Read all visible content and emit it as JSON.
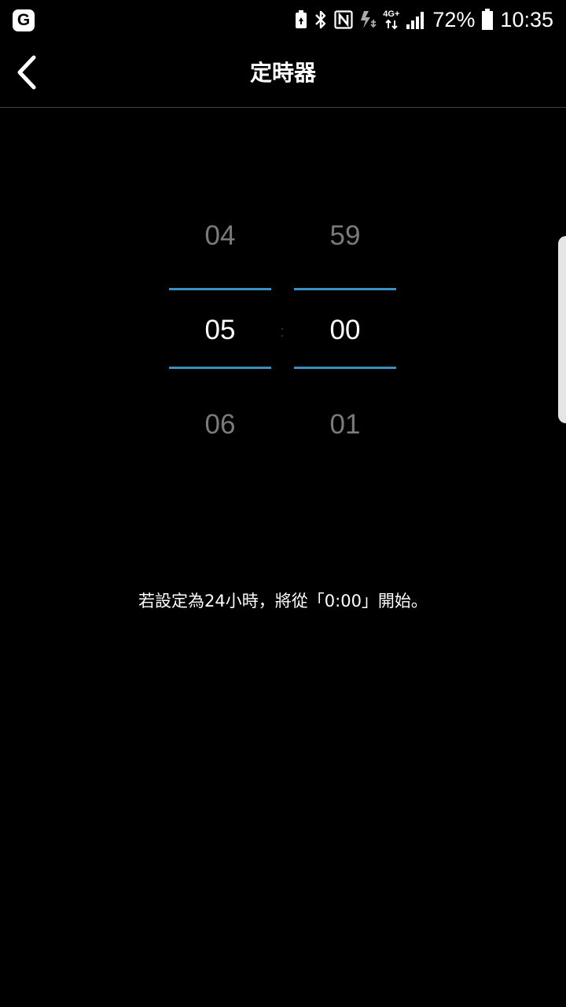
{
  "status_bar": {
    "app_icon_letter": "G",
    "network": "4G+",
    "battery_percent": "72%",
    "time": "10:35",
    "icons": [
      "app-g-icon",
      "battery-saver-icon",
      "bluetooth-icon",
      "nfc-icon",
      "data-saver-icon",
      "mobile-data-icon",
      "signal-icon",
      "battery-icon"
    ]
  },
  "header": {
    "title": "定時器",
    "back_icon": "chevron-left-icon"
  },
  "picker": {
    "hours": {
      "prev": "04",
      "current": "05",
      "next": "06"
    },
    "minutes": {
      "prev": "59",
      "current": "00",
      "next": "01"
    },
    "separator": ":",
    "accent_color": "#3b8fc4"
  },
  "hint": "若設定為24小時，將從「0:00」開始。"
}
